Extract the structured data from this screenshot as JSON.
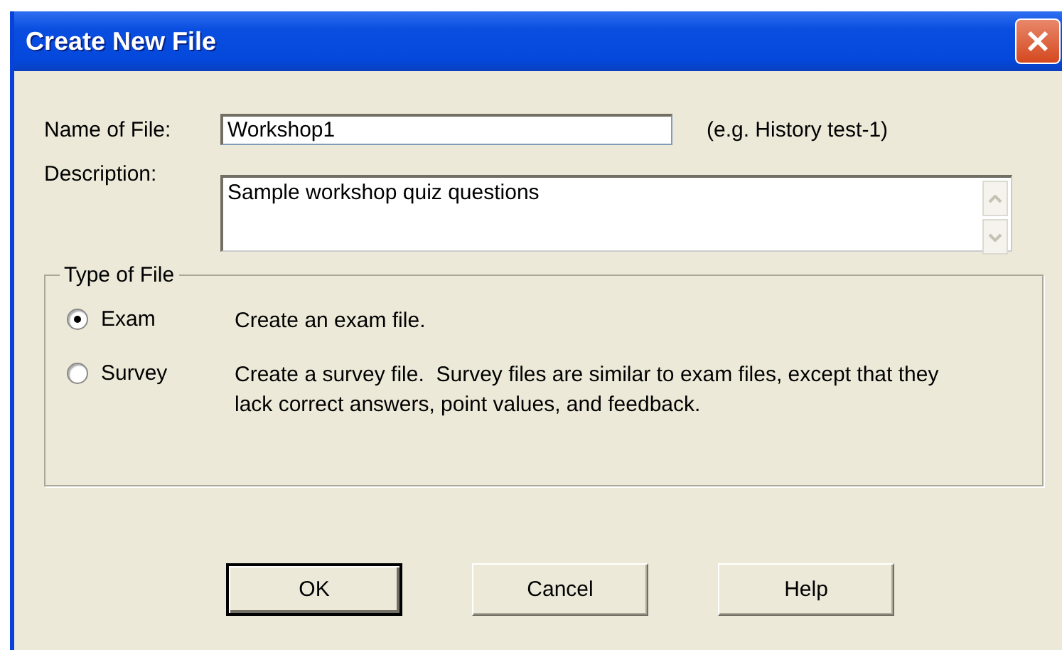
{
  "window": {
    "title": "Create New File"
  },
  "fields": [
    {
      "kind": "line",
      "label": "Name of File:",
      "value": "Workshop1",
      "hint": "(e.g. History test-1)"
    },
    {
      "kind": "area",
      "label": "Description:",
      "value": "Sample workshop quiz questions"
    }
  ],
  "file_type": {
    "title": "Type of File",
    "options": [
      {
        "label": "Exam",
        "description": "Create an exam file.",
        "selected": true
      },
      {
        "label": "Survey",
        "description": "Create a survey file.  Survey files are similar to exam files, except that they lack correct answers, point values, and feedback.",
        "selected": false
      }
    ]
  },
  "buttons": [
    {
      "label": "OK",
      "default": true
    },
    {
      "label": "Cancel",
      "default": false
    },
    {
      "label": "Help",
      "default": false
    }
  ]
}
